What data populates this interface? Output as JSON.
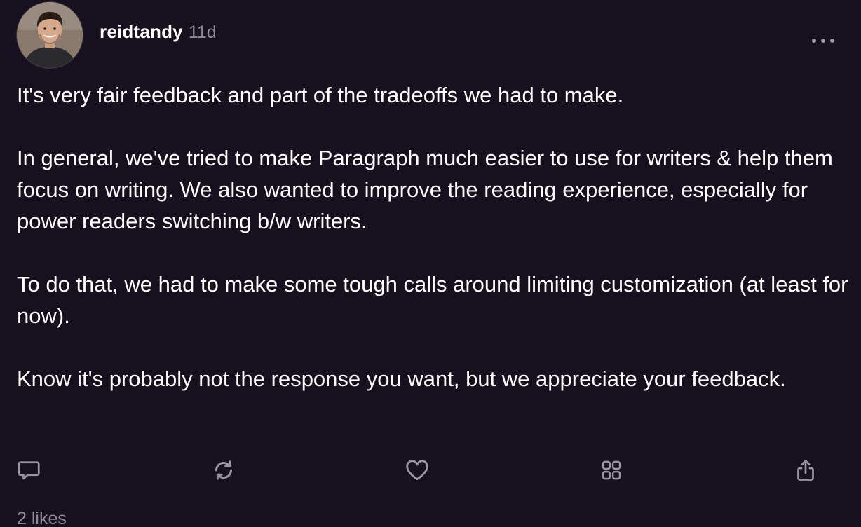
{
  "post": {
    "author": {
      "username": "reidtandy",
      "avatar_icon": "avatar-photo"
    },
    "timestamp": "11d",
    "more_icon": "more-horizontal-icon",
    "paragraphs": [
      "It's very fair feedback and part of the tradeoffs we had to make.",
      "In general, we've tried to make Paragraph much easier to use for writers & help them focus on writing. We also wanted to improve the reading experience, especially for power readers switching b/w writers.",
      "To do that, we had to make some tough calls around limiting customization (at least for now).",
      "Know it's probably not the response you want, but we appreciate your feedback."
    ],
    "actions": [
      {
        "name": "reply",
        "icon": "comment-icon"
      },
      {
        "name": "recast",
        "icon": "refresh-icon"
      },
      {
        "name": "like",
        "icon": "heart-icon"
      },
      {
        "name": "collect",
        "icon": "grid-icon"
      },
      {
        "name": "share",
        "icon": "share-icon"
      }
    ],
    "likes_label": "2 likes"
  },
  "colors": {
    "background": "#17101f",
    "text": "#ffffff",
    "muted": "#8f8a99",
    "icon": "#9a95a3"
  }
}
